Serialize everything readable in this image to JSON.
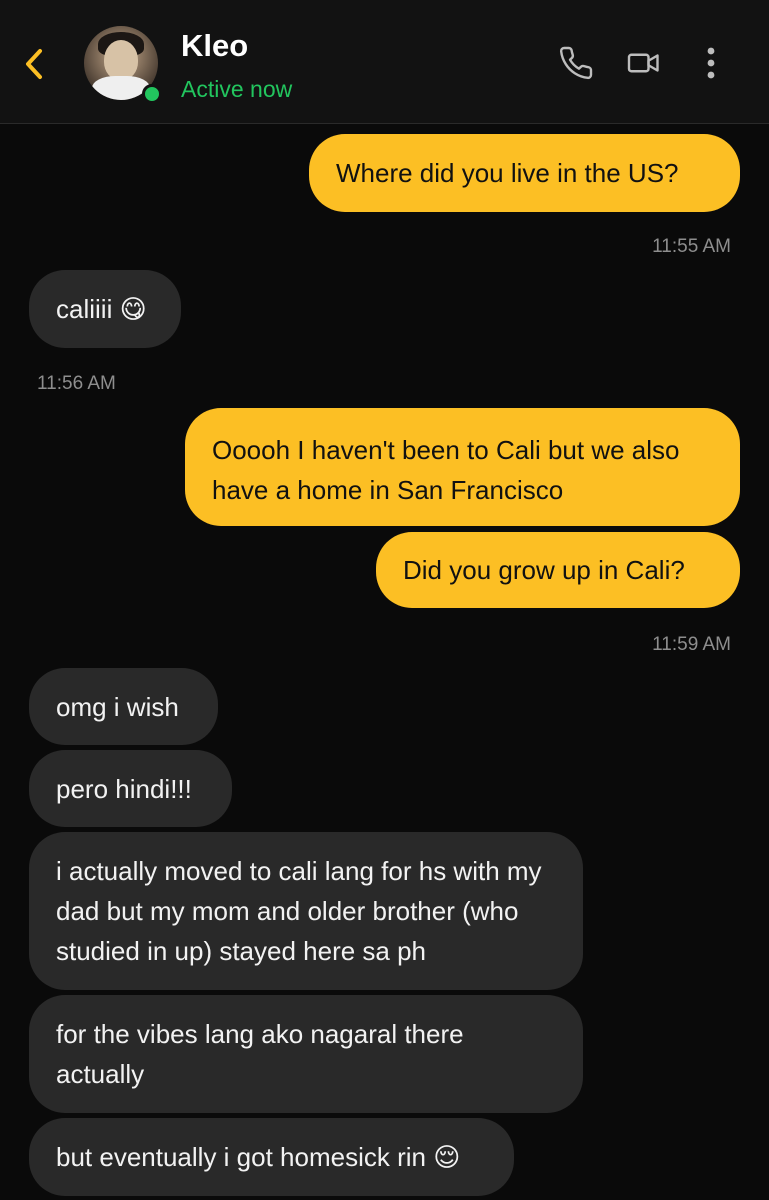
{
  "contact": {
    "name": "Kleo",
    "status": "Active now"
  },
  "colors": {
    "accent": "#fcbf24",
    "online": "#22c55e",
    "incoming_bubble": "#292929",
    "background": "#0a0a0a"
  },
  "icons": {
    "back": "chevron-left-icon",
    "call": "phone-icon",
    "video": "video-camera-icon",
    "more": "more-vertical-icon"
  },
  "messages": [
    {
      "from": "me",
      "text": "Where did you live in the US?"
    },
    {
      "time": "11:55 AM"
    },
    {
      "from": "them",
      "text": "caliiii 😋"
    },
    {
      "time": "11:56 AM"
    },
    {
      "from": "me",
      "text": "Ooooh I haven't been to Cali but we also have a home in San Francisco"
    },
    {
      "from": "me",
      "text": "Did you grow up in Cali?"
    },
    {
      "time": "11:59 AM"
    },
    {
      "from": "them",
      "text": "omg i wish"
    },
    {
      "from": "them",
      "text": "pero hindi!!!"
    },
    {
      "from": "them",
      "text": "i actually moved to cali lang for hs with my dad but my mom and older brother (who studied in up) stayed here sa ph"
    },
    {
      "from": "them",
      "text": "for the vibes lang ako nagaral there actually"
    },
    {
      "from": "them",
      "text": "but eventually i got homesick rin 😌"
    }
  ]
}
